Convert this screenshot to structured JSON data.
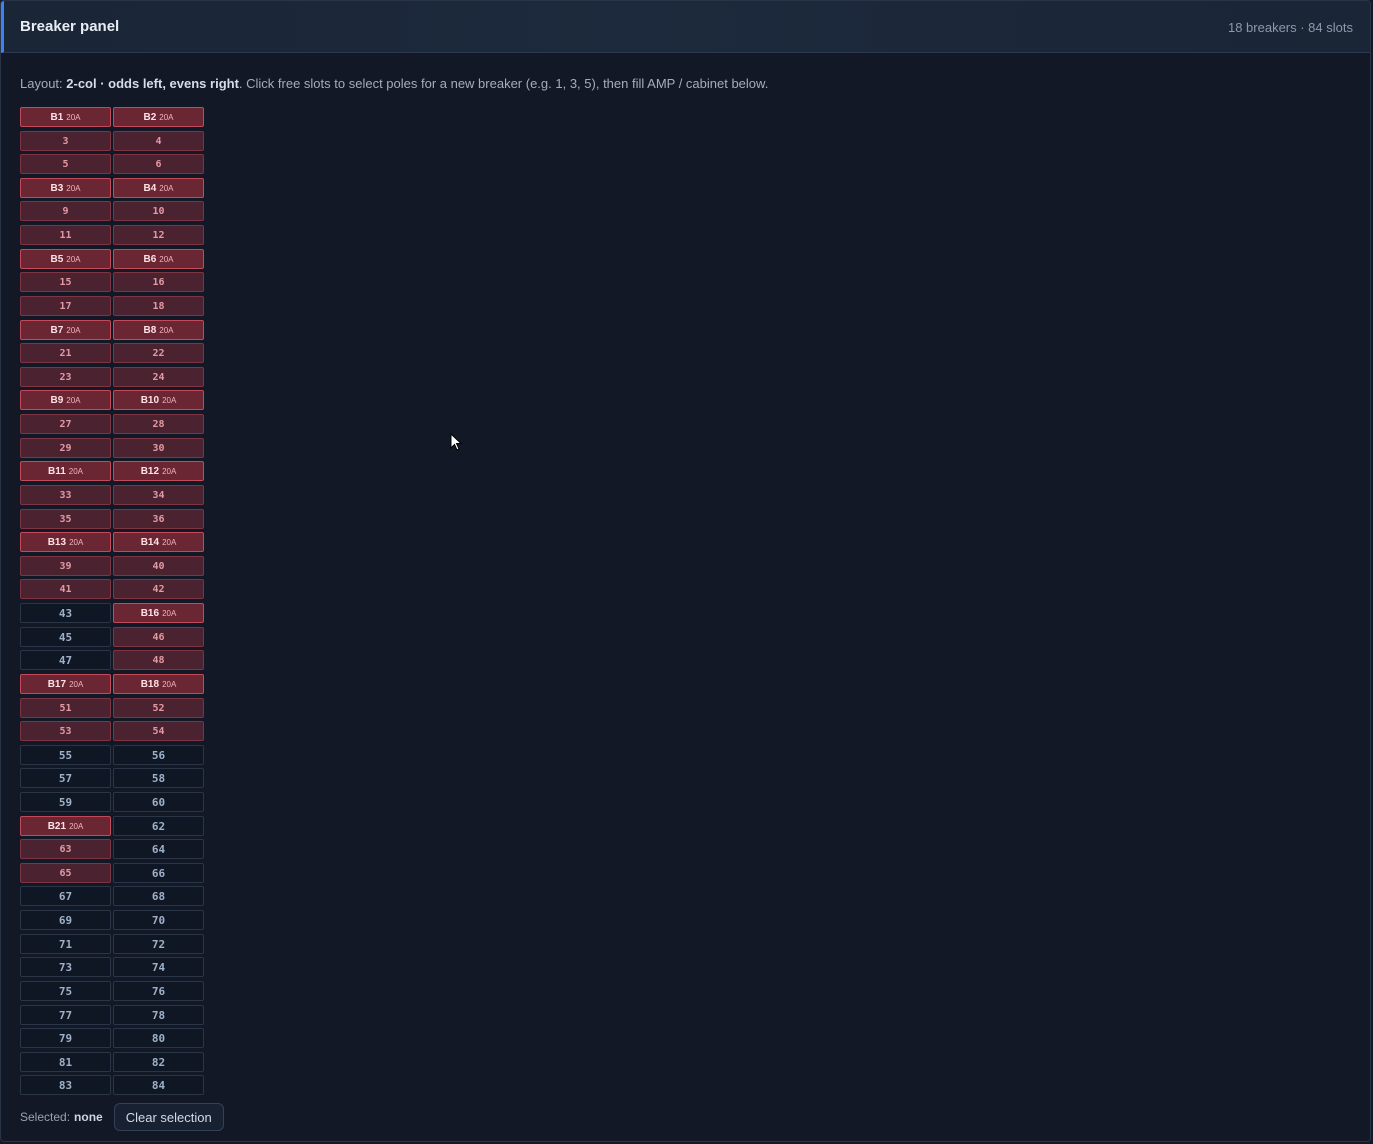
{
  "header": {
    "title": "Breaker panel",
    "summary": "18 breakers · 84 slots"
  },
  "layout_line": {
    "prefix": "Layout: ",
    "layout_name": "2-col · odds left, evens right",
    "instructions": ". Click free slots to select poles for a new breaker (e.g. 1, 3, 5), then fill AMP / cabinet below."
  },
  "slots": [
    {
      "n": 1,
      "state": "head",
      "label": "B1",
      "amp": "20A"
    },
    {
      "n": 2,
      "state": "head",
      "label": "B2",
      "amp": "20A"
    },
    {
      "n": 3,
      "state": "used"
    },
    {
      "n": 4,
      "state": "used"
    },
    {
      "n": 5,
      "state": "used"
    },
    {
      "n": 6,
      "state": "used"
    },
    {
      "n": 7,
      "state": "head",
      "label": "B3",
      "amp": "20A"
    },
    {
      "n": 8,
      "state": "head",
      "label": "B4",
      "amp": "20A"
    },
    {
      "n": 9,
      "state": "used"
    },
    {
      "n": 10,
      "state": "used"
    },
    {
      "n": 11,
      "state": "used"
    },
    {
      "n": 12,
      "state": "used"
    },
    {
      "n": 13,
      "state": "head",
      "label": "B5",
      "amp": "20A"
    },
    {
      "n": 14,
      "state": "head",
      "label": "B6",
      "amp": "20A"
    },
    {
      "n": 15,
      "state": "used"
    },
    {
      "n": 16,
      "state": "used"
    },
    {
      "n": 17,
      "state": "used"
    },
    {
      "n": 18,
      "state": "used"
    },
    {
      "n": 19,
      "state": "head",
      "label": "B7",
      "amp": "20A"
    },
    {
      "n": 20,
      "state": "head",
      "label": "B8",
      "amp": "20A"
    },
    {
      "n": 21,
      "state": "used"
    },
    {
      "n": 22,
      "state": "used"
    },
    {
      "n": 23,
      "state": "used"
    },
    {
      "n": 24,
      "state": "used"
    },
    {
      "n": 25,
      "state": "head",
      "label": "B9",
      "amp": "20A"
    },
    {
      "n": 26,
      "state": "head",
      "label": "B10",
      "amp": "20A"
    },
    {
      "n": 27,
      "state": "used"
    },
    {
      "n": 28,
      "state": "used"
    },
    {
      "n": 29,
      "state": "used"
    },
    {
      "n": 30,
      "state": "used"
    },
    {
      "n": 31,
      "state": "head",
      "label": "B11",
      "amp": "20A"
    },
    {
      "n": 32,
      "state": "head",
      "label": "B12",
      "amp": "20A"
    },
    {
      "n": 33,
      "state": "used"
    },
    {
      "n": 34,
      "state": "used"
    },
    {
      "n": 35,
      "state": "used"
    },
    {
      "n": 36,
      "state": "used"
    },
    {
      "n": 37,
      "state": "head",
      "label": "B13",
      "amp": "20A"
    },
    {
      "n": 38,
      "state": "head",
      "label": "B14",
      "amp": "20A"
    },
    {
      "n": 39,
      "state": "used"
    },
    {
      "n": 40,
      "state": "used"
    },
    {
      "n": 41,
      "state": "used"
    },
    {
      "n": 42,
      "state": "used"
    },
    {
      "n": 43,
      "state": "free"
    },
    {
      "n": 44,
      "state": "head",
      "label": "B16",
      "amp": "20A"
    },
    {
      "n": 45,
      "state": "free"
    },
    {
      "n": 46,
      "state": "used"
    },
    {
      "n": 47,
      "state": "free"
    },
    {
      "n": 48,
      "state": "used"
    },
    {
      "n": 49,
      "state": "head",
      "label": "B17",
      "amp": "20A"
    },
    {
      "n": 50,
      "state": "head",
      "label": "B18",
      "amp": "20A"
    },
    {
      "n": 51,
      "state": "used"
    },
    {
      "n": 52,
      "state": "used"
    },
    {
      "n": 53,
      "state": "used"
    },
    {
      "n": 54,
      "state": "used"
    },
    {
      "n": 55,
      "state": "free"
    },
    {
      "n": 56,
      "state": "free"
    },
    {
      "n": 57,
      "state": "free"
    },
    {
      "n": 58,
      "state": "free"
    },
    {
      "n": 59,
      "state": "free"
    },
    {
      "n": 60,
      "state": "free"
    },
    {
      "n": 61,
      "state": "head",
      "label": "B21",
      "amp": "20A"
    },
    {
      "n": 62,
      "state": "free"
    },
    {
      "n": 63,
      "state": "used"
    },
    {
      "n": 64,
      "state": "free"
    },
    {
      "n": 65,
      "state": "used"
    },
    {
      "n": 66,
      "state": "free"
    },
    {
      "n": 67,
      "state": "free"
    },
    {
      "n": 68,
      "state": "free"
    },
    {
      "n": 69,
      "state": "free"
    },
    {
      "n": 70,
      "state": "free"
    },
    {
      "n": 71,
      "state": "free"
    },
    {
      "n": 72,
      "state": "free"
    },
    {
      "n": 73,
      "state": "free"
    },
    {
      "n": 74,
      "state": "free"
    },
    {
      "n": 75,
      "state": "free"
    },
    {
      "n": 76,
      "state": "free"
    },
    {
      "n": 77,
      "state": "free"
    },
    {
      "n": 78,
      "state": "free"
    },
    {
      "n": 79,
      "state": "free"
    },
    {
      "n": 80,
      "state": "free"
    },
    {
      "n": 81,
      "state": "free"
    },
    {
      "n": 82,
      "state": "free"
    },
    {
      "n": 83,
      "state": "free"
    },
    {
      "n": 84,
      "state": "free"
    }
  ],
  "footer": {
    "selected_label": "Selected:",
    "selected_value": "none",
    "clear_label": "Clear selection"
  },
  "colors": {
    "accent": "#3b82f6",
    "breaker_head": "#6b2634",
    "breaker_pole": "#4a2230",
    "free_slot": "#0f1724",
    "background": "#121826"
  }
}
